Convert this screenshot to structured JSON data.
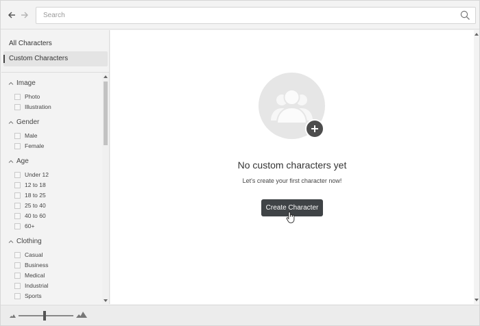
{
  "search": {
    "placeholder": "Search"
  },
  "sidebar": {
    "nav": [
      {
        "label": "All Characters",
        "active": false
      },
      {
        "label": "Custom Characters",
        "active": true
      }
    ],
    "filters": {
      "image": {
        "title": "Image",
        "options": [
          "Photo",
          "Illustration"
        ]
      },
      "gender": {
        "title": "Gender",
        "options": [
          "Male",
          "Female"
        ]
      },
      "age": {
        "title": "Age",
        "options": [
          "Under 12",
          "12 to 18",
          "18 to 25",
          "25 to 40",
          "40 to 60",
          "60+"
        ]
      },
      "clothing": {
        "title": "Clothing",
        "options": [
          "Casual",
          "Business",
          "Medical",
          "Industrial",
          "Sports"
        ]
      }
    }
  },
  "main": {
    "empty_title": "No custom characters yet",
    "empty_subtitle": "Let's create your first character now!",
    "create_button": "Create Character"
  },
  "zoom": {
    "level": 0.47
  },
  "colors": {
    "button_bg": "#3f4346",
    "avatar_bg": "#e6e6e6",
    "badge_bg": "#4d4d4d"
  }
}
